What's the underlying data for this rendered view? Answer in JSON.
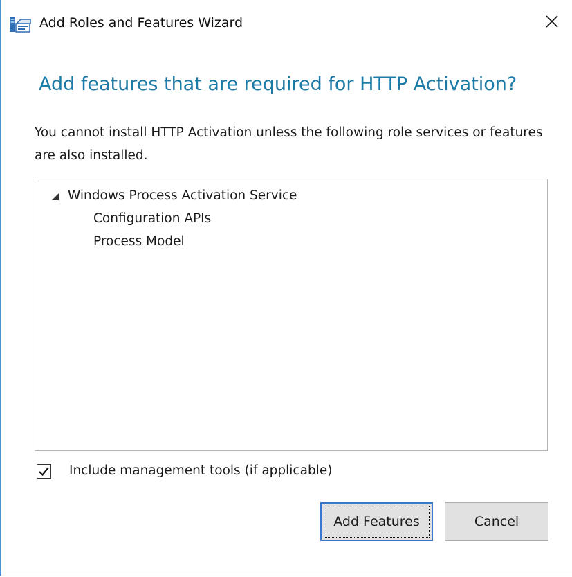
{
  "window": {
    "title": "Add Roles and Features Wizard"
  },
  "dialog": {
    "heading": "Add features that are required for HTTP Activation?",
    "description": "You cannot install HTTP Activation unless the following role services or features are also installed."
  },
  "tree": {
    "items": [
      {
        "label": "Windows Process Activation Service",
        "expanded": true
      },
      {
        "label": "Configuration APIs"
      },
      {
        "label": "Process Model"
      }
    ]
  },
  "options": {
    "include_tools_label": "Include management tools (if applicable)",
    "include_tools_checked": true
  },
  "buttons": {
    "add_features": "Add Features",
    "cancel": "Cancel"
  },
  "colors": {
    "heading": "#1c7ba6",
    "window_border": "#4a8fd6",
    "button_face": "#e1e1e1",
    "default_button_border": "#3a78c9"
  },
  "icons": {
    "app": "server-manager-icon",
    "close": "close-icon",
    "expand": "expanded-triangle-icon",
    "check": "checkmark-icon"
  }
}
